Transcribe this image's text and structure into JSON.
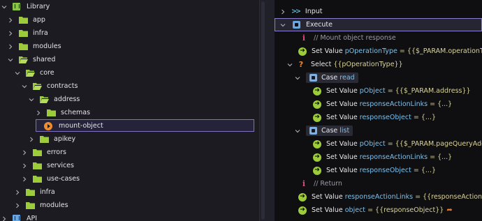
{
  "tree": {
    "root": {
      "label": "Library"
    },
    "items": [
      {
        "label": "app"
      },
      {
        "label": "infra"
      },
      {
        "label": "modules"
      },
      {
        "label": "shared"
      },
      {
        "label": "core"
      },
      {
        "label": "contracts"
      },
      {
        "label": "address"
      },
      {
        "label": "schemas"
      },
      {
        "label": "mount-object"
      },
      {
        "label": "apikey"
      },
      {
        "label": "errors"
      },
      {
        "label": "services"
      },
      {
        "label": "use-cases"
      },
      {
        "label": "infra"
      },
      {
        "label": "modules"
      },
      {
        "label": "API"
      }
    ],
    "selected": "mount-object"
  },
  "flow": {
    "input": "Input",
    "execute": "Execute",
    "comment1": "// Mount object response",
    "set_value": "Set Value",
    "l_pOperationType_var": "pOperationType",
    "l_pOperationType_expr": "= {{$_PARAM.operationType}}",
    "select_kw": "Select",
    "select_expr": "{{pOperationType}}",
    "case_kw": "Case",
    "case_read": "read",
    "case_list": "list",
    "read_pObject_var": "pObject",
    "read_pObject_expr": "= {{$_PARAM.address}}",
    "responseActionLinks_var": "responseActionLinks",
    "ellipsis_expr": "= {...}",
    "responseObject_var": "responseObject",
    "list_pObject_expr": "= {{$_PARAM.pageQueryAddresses}}",
    "comment2": "// Return",
    "ret1_expr": "= {{responseActionLinks}}",
    "object_var": "object",
    "ret2_expr": "= {{responseObject}}"
  },
  "colors": {
    "accent": "#8a7fd0",
    "variable": "#7ec0ea",
    "expression": "#d9d39a",
    "set_icon": "#9ccc3a",
    "return_icon": "#e6762e"
  }
}
